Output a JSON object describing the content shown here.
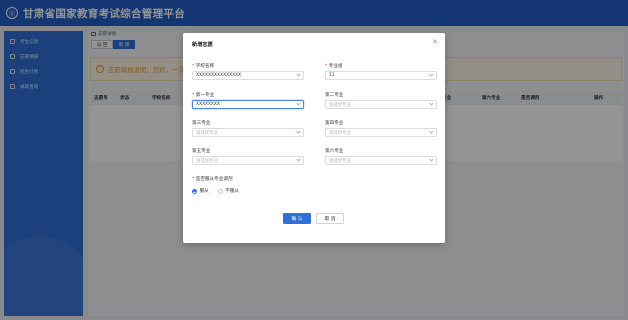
{
  "app": {
    "title": "甘肃省国家教育考试综合管理平台",
    "logo_text": "⓪"
  },
  "sidebar": {
    "items": [
      {
        "label": "考生信息",
        "icon": "user-icon"
      },
      {
        "label": "志愿填报",
        "icon": "form-icon"
      },
      {
        "label": "招生计划",
        "icon": "plan-icon"
      },
      {
        "label": "录取查询",
        "icon": "search-icon"
      }
    ]
  },
  "main": {
    "breadcrumb": "志愿详情",
    "back_label": "返 回",
    "add_label": "新 增",
    "notice": "志愿填报说明：您好，一次…",
    "table_headers": [
      "志愿号",
      "状态",
      "学校名称",
      "专业",
      "第六专业",
      "是否调剂",
      "操作"
    ]
  },
  "dialog": {
    "title": "新增志愿",
    "fields": {
      "school": {
        "label": "学校名称",
        "required": true,
        "value": "XXXXXXXXXXXXXXX"
      },
      "major_group": {
        "label": "专业组",
        "required": true,
        "value": "11"
      },
      "major1": {
        "label": "第一专业",
        "required": true,
        "value": "XXXXXXXX"
      },
      "major2": {
        "label": "第二专业",
        "required": false,
        "placeholder": "请选择专业"
      },
      "major3": {
        "label": "第三专业",
        "required": false,
        "placeholder": "请选择专业"
      },
      "major4": {
        "label": "第四专业",
        "required": false,
        "placeholder": "请选择专业"
      },
      "major5": {
        "label": "第五专业",
        "required": false,
        "placeholder": "请选择专业"
      },
      "major6": {
        "label": "第六专业",
        "required": false,
        "placeholder": "请选择专业"
      }
    },
    "adjust": {
      "label": "是否服从专业调剂",
      "options": [
        "服从",
        "不服从"
      ],
      "selected": "服从"
    },
    "confirm_label": "确 认",
    "cancel_label": "取 消"
  }
}
